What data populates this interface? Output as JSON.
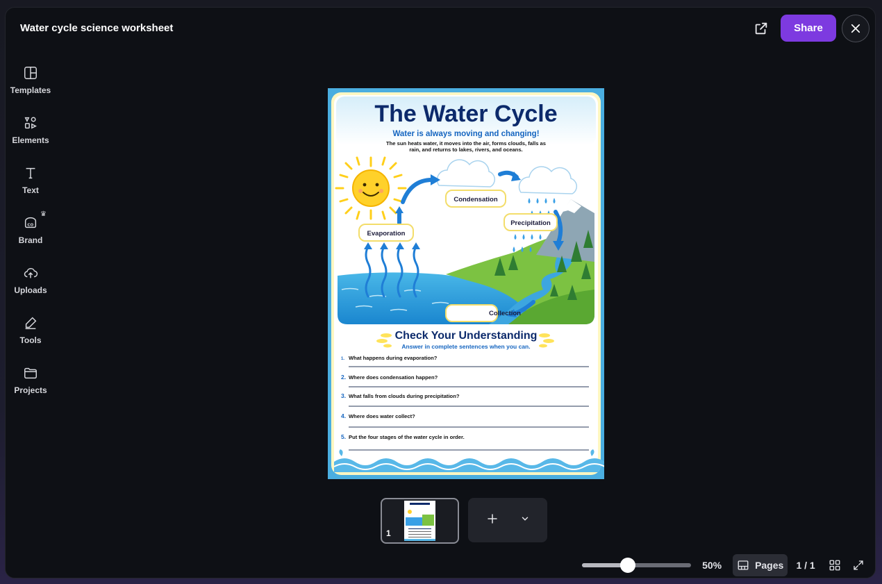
{
  "header": {
    "title": "Water cycle science worksheet",
    "share_label": "Share"
  },
  "sidebar": {
    "items": [
      {
        "label": "Templates",
        "icon": "templates-icon"
      },
      {
        "label": "Elements",
        "icon": "elements-icon"
      },
      {
        "label": "Text",
        "icon": "text-icon"
      },
      {
        "label": "Brand",
        "icon": "brand-icon"
      },
      {
        "label": "Uploads",
        "icon": "uploads-icon"
      },
      {
        "label": "Tools",
        "icon": "tools-icon"
      },
      {
        "label": "Projects",
        "icon": "projects-icon"
      }
    ]
  },
  "document": {
    "title": "The Water Cycle",
    "subtitle": "Water is always moving and changing!",
    "intro_line1": "The sun heats water, it moves into the air, forms clouds, falls as",
    "intro_line2": "rain, and returns to lakes, rivers, and oceans.",
    "labels": {
      "condensation": "Condensation",
      "precipitation": "Precipitation",
      "evaporation": "Evaporation",
      "collection": "Collection"
    },
    "check_title": "Check Your Understanding",
    "check_subtitle": "Answer in complete sentences when you can.",
    "questions": [
      {
        "num": "1.",
        "text": "What happens during evaporation?"
      },
      {
        "num": "2.",
        "text": "Where does condensation happen?"
      },
      {
        "num": "3.",
        "text": "What falls from clouds during precipitation?"
      },
      {
        "num": "4.",
        "text": "Where does water collect?"
      },
      {
        "num": "5.",
        "text": "Put the four stages of the water cycle in order."
      }
    ]
  },
  "pages": {
    "thumbnail_number": "1",
    "count_label": "1 / 1",
    "pages_label": "Pages"
  },
  "zoom": {
    "label": "50%",
    "level_fraction": 0.42
  },
  "colors": {
    "accent": "#7d3ae0",
    "title_blue": "#0c2a6b",
    "subtitle_blue": "#1565c0"
  }
}
